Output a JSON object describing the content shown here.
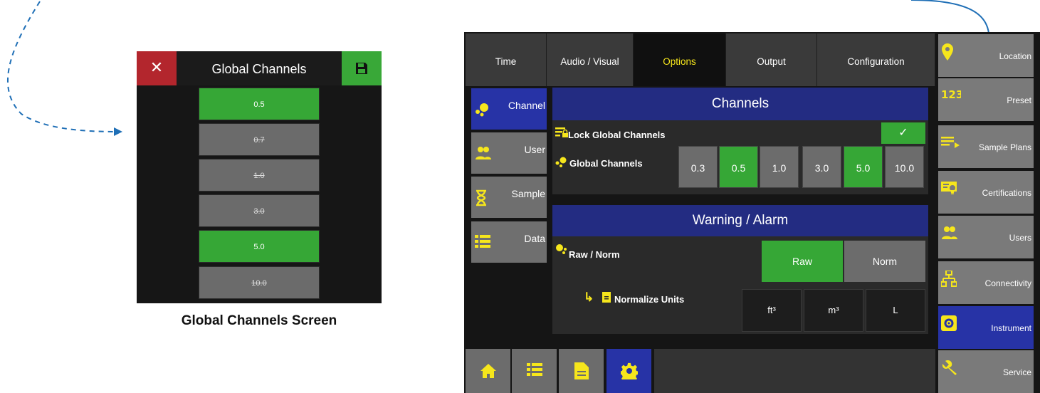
{
  "global_channels_screen": {
    "title": "Global Channels",
    "close_glyph": "✕",
    "channels": [
      {
        "label": "0.5",
        "enabled": true
      },
      {
        "label": "0.7",
        "enabled": false
      },
      {
        "label": "1.0",
        "enabled": false
      },
      {
        "label": "3.0",
        "enabled": false
      },
      {
        "label": "5.0",
        "enabled": true
      },
      {
        "label": "10.0",
        "enabled": false
      }
    ],
    "caption": "Global Channels Screen"
  },
  "device": {
    "tabs": [
      "Time",
      "Audio / Visual",
      "Options",
      "Output",
      "Configuration"
    ],
    "active_tab": "Options",
    "side_items": [
      "Channel",
      "User",
      "Sample",
      "Data"
    ],
    "active_side_item": "Channel",
    "channels_section": {
      "header": "Channels",
      "lock_label": "Lock Global Channels",
      "lock_check": "✓",
      "global_label": "Global Channels",
      "channel_buttons": [
        {
          "label": "0.3",
          "enabled": false
        },
        {
          "label": "0.5",
          "enabled": true
        },
        {
          "label": "1.0",
          "enabled": false
        },
        {
          "label": "3.0",
          "enabled": false
        },
        {
          "label": "5.0",
          "enabled": true
        },
        {
          "label": "10.0",
          "enabled": false
        }
      ]
    },
    "warning_section": {
      "header": "Warning / Alarm",
      "raw_norm_label": "Raw / Norm",
      "raw_label": "Raw",
      "norm_label": "Norm",
      "normalize_arrow": "↳",
      "normalize_label": "Normalize Units",
      "units": [
        "ft³",
        "m³",
        "L"
      ]
    },
    "right_nav": [
      "Location",
      "Preset",
      "Sample Plans",
      "Certifications",
      "Users",
      "Connectivity",
      "Instrument",
      "Service"
    ],
    "active_right_nav": "Instrument",
    "bottom_nav_icons": [
      "home-icon",
      "list-icon",
      "document-icon",
      "gear-icon"
    ],
    "active_bottom_nav": "gear-icon"
  },
  "colors": {
    "accent_yellow": "#f6e61c",
    "active_blue": "#2733a6",
    "enabled_green": "#36a736",
    "close_red": "#b3262d",
    "arrow_blue": "#1f6fb6"
  }
}
